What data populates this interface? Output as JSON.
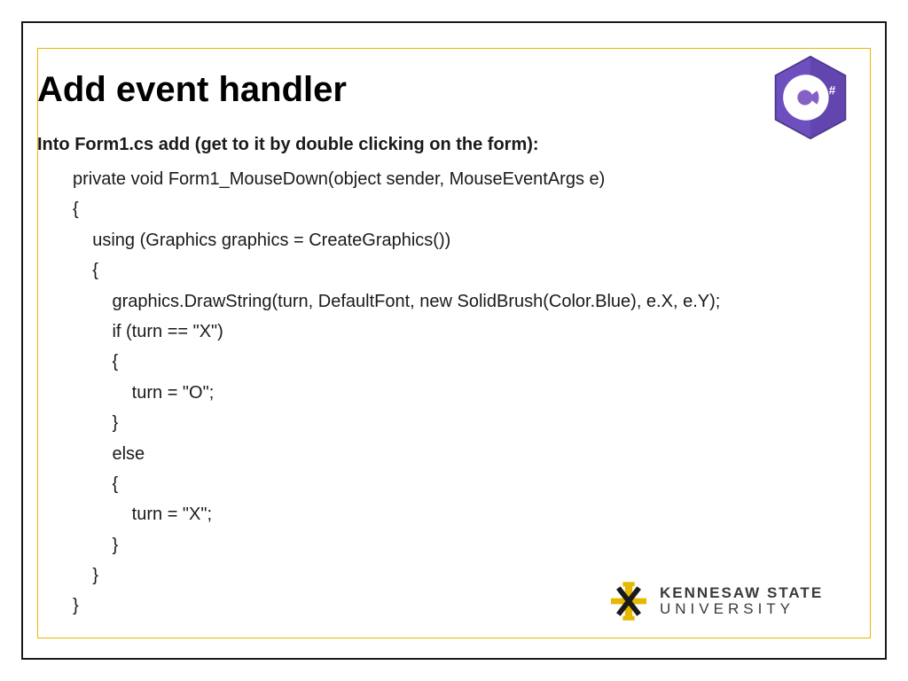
{
  "title": "Add event handler",
  "lead": "Into Form1.cs add (get to it by double clicking on the form):",
  "code": "private void Form1_MouseDown(object sender, MouseEventArgs e)\n{\n    using (Graphics graphics = CreateGraphics())\n    {\n        graphics.DrawString(turn, DefaultFont, new SolidBrush(Color.Blue), e.X, e.Y);\n        if (turn == \"X\")\n        {\n            turn = \"O\";\n        }\n        else\n        {\n            turn = \"X\";\n        }\n    }\n}",
  "logos": {
    "csharp": "csharp-logo-icon",
    "ksu_line1": "KENNESAW STATE",
    "ksu_line2": "UNIVERSITY"
  }
}
